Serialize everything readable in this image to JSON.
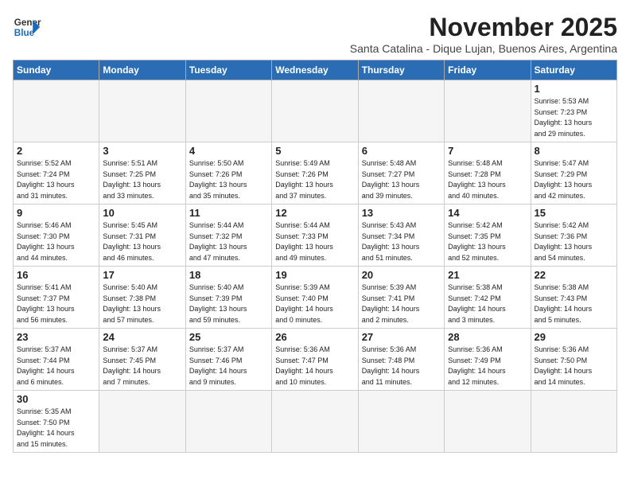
{
  "header": {
    "logo_line1": "General",
    "logo_line2": "Blue",
    "month": "November 2025",
    "subtitle": "Santa Catalina - Dique Lujan, Buenos Aires, Argentina"
  },
  "weekdays": [
    "Sunday",
    "Monday",
    "Tuesday",
    "Wednesday",
    "Thursday",
    "Friday",
    "Saturday"
  ],
  "weeks": [
    [
      {
        "day": "",
        "info": ""
      },
      {
        "day": "",
        "info": ""
      },
      {
        "day": "",
        "info": ""
      },
      {
        "day": "",
        "info": ""
      },
      {
        "day": "",
        "info": ""
      },
      {
        "day": "",
        "info": ""
      },
      {
        "day": "1",
        "info": "Sunrise: 5:53 AM\nSunset: 7:23 PM\nDaylight: 13 hours\nand 29 minutes."
      }
    ],
    [
      {
        "day": "2",
        "info": "Sunrise: 5:52 AM\nSunset: 7:24 PM\nDaylight: 13 hours\nand 31 minutes."
      },
      {
        "day": "3",
        "info": "Sunrise: 5:51 AM\nSunset: 7:25 PM\nDaylight: 13 hours\nand 33 minutes."
      },
      {
        "day": "4",
        "info": "Sunrise: 5:50 AM\nSunset: 7:26 PM\nDaylight: 13 hours\nand 35 minutes."
      },
      {
        "day": "5",
        "info": "Sunrise: 5:49 AM\nSunset: 7:26 PM\nDaylight: 13 hours\nand 37 minutes."
      },
      {
        "day": "6",
        "info": "Sunrise: 5:48 AM\nSunset: 7:27 PM\nDaylight: 13 hours\nand 39 minutes."
      },
      {
        "day": "7",
        "info": "Sunrise: 5:48 AM\nSunset: 7:28 PM\nDaylight: 13 hours\nand 40 minutes."
      },
      {
        "day": "8",
        "info": "Sunrise: 5:47 AM\nSunset: 7:29 PM\nDaylight: 13 hours\nand 42 minutes."
      }
    ],
    [
      {
        "day": "9",
        "info": "Sunrise: 5:46 AM\nSunset: 7:30 PM\nDaylight: 13 hours\nand 44 minutes."
      },
      {
        "day": "10",
        "info": "Sunrise: 5:45 AM\nSunset: 7:31 PM\nDaylight: 13 hours\nand 46 minutes."
      },
      {
        "day": "11",
        "info": "Sunrise: 5:44 AM\nSunset: 7:32 PM\nDaylight: 13 hours\nand 47 minutes."
      },
      {
        "day": "12",
        "info": "Sunrise: 5:44 AM\nSunset: 7:33 PM\nDaylight: 13 hours\nand 49 minutes."
      },
      {
        "day": "13",
        "info": "Sunrise: 5:43 AM\nSunset: 7:34 PM\nDaylight: 13 hours\nand 51 minutes."
      },
      {
        "day": "14",
        "info": "Sunrise: 5:42 AM\nSunset: 7:35 PM\nDaylight: 13 hours\nand 52 minutes."
      },
      {
        "day": "15",
        "info": "Sunrise: 5:42 AM\nSunset: 7:36 PM\nDaylight: 13 hours\nand 54 minutes."
      }
    ],
    [
      {
        "day": "16",
        "info": "Sunrise: 5:41 AM\nSunset: 7:37 PM\nDaylight: 13 hours\nand 56 minutes."
      },
      {
        "day": "17",
        "info": "Sunrise: 5:40 AM\nSunset: 7:38 PM\nDaylight: 13 hours\nand 57 minutes."
      },
      {
        "day": "18",
        "info": "Sunrise: 5:40 AM\nSunset: 7:39 PM\nDaylight: 13 hours\nand 59 minutes."
      },
      {
        "day": "19",
        "info": "Sunrise: 5:39 AM\nSunset: 7:40 PM\nDaylight: 14 hours\nand 0 minutes."
      },
      {
        "day": "20",
        "info": "Sunrise: 5:39 AM\nSunset: 7:41 PM\nDaylight: 14 hours\nand 2 minutes."
      },
      {
        "day": "21",
        "info": "Sunrise: 5:38 AM\nSunset: 7:42 PM\nDaylight: 14 hours\nand 3 minutes."
      },
      {
        "day": "22",
        "info": "Sunrise: 5:38 AM\nSunset: 7:43 PM\nDaylight: 14 hours\nand 5 minutes."
      }
    ],
    [
      {
        "day": "23",
        "info": "Sunrise: 5:37 AM\nSunset: 7:44 PM\nDaylight: 14 hours\nand 6 minutes."
      },
      {
        "day": "24",
        "info": "Sunrise: 5:37 AM\nSunset: 7:45 PM\nDaylight: 14 hours\nand 7 minutes."
      },
      {
        "day": "25",
        "info": "Sunrise: 5:37 AM\nSunset: 7:46 PM\nDaylight: 14 hours\nand 9 minutes."
      },
      {
        "day": "26",
        "info": "Sunrise: 5:36 AM\nSunset: 7:47 PM\nDaylight: 14 hours\nand 10 minutes."
      },
      {
        "day": "27",
        "info": "Sunrise: 5:36 AM\nSunset: 7:48 PM\nDaylight: 14 hours\nand 11 minutes."
      },
      {
        "day": "28",
        "info": "Sunrise: 5:36 AM\nSunset: 7:49 PM\nDaylight: 14 hours\nand 12 minutes."
      },
      {
        "day": "29",
        "info": "Sunrise: 5:36 AM\nSunset: 7:50 PM\nDaylight: 14 hours\nand 14 minutes."
      }
    ],
    [
      {
        "day": "30",
        "info": "Sunrise: 5:35 AM\nSunset: 7:50 PM\nDaylight: 14 hours\nand 15 minutes."
      },
      {
        "day": "",
        "info": ""
      },
      {
        "day": "",
        "info": ""
      },
      {
        "day": "",
        "info": ""
      },
      {
        "day": "",
        "info": ""
      },
      {
        "day": "",
        "info": ""
      },
      {
        "day": "",
        "info": ""
      }
    ]
  ]
}
